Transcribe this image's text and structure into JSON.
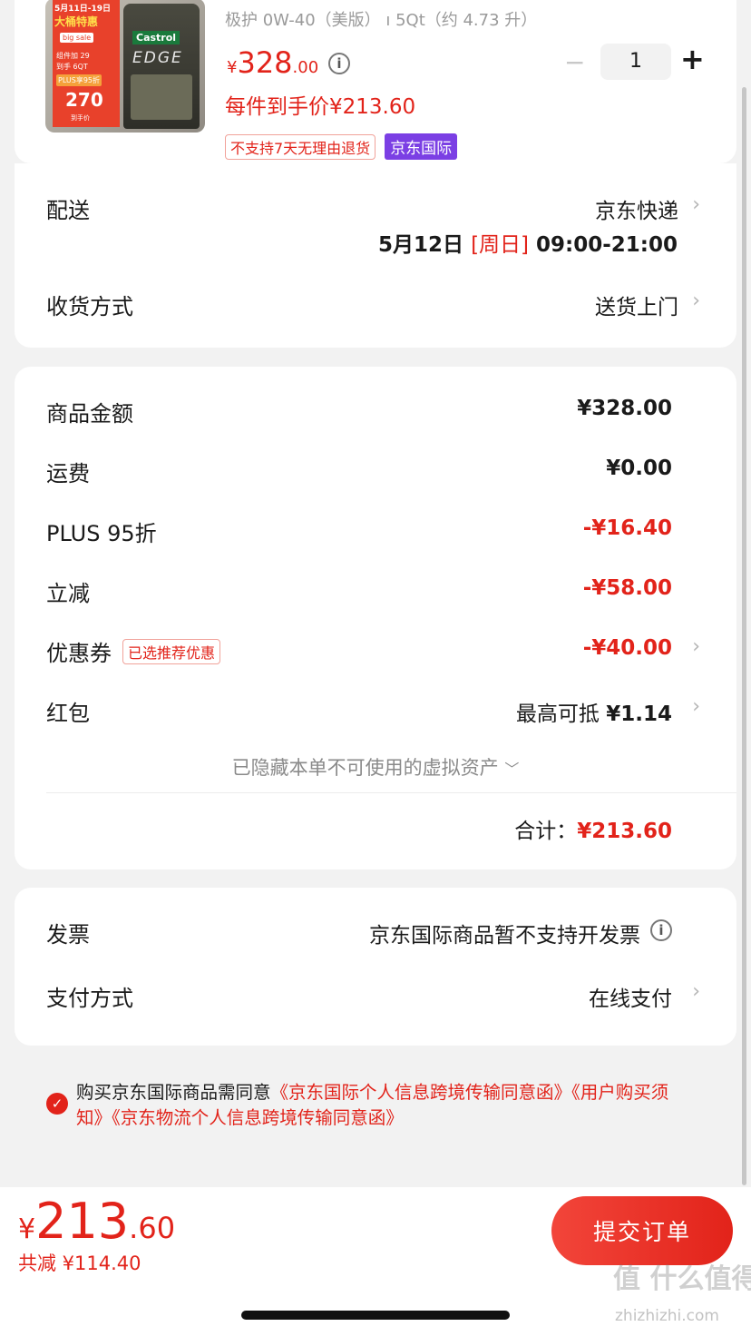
{
  "product": {
    "title_partial": "极护 0W-40（美版） ı 5Qt（约 4.73 升）",
    "price_symbol": "¥",
    "price_int": "328",
    "price_dec": ".00",
    "per_item_price": "每件到手价¥213.60",
    "quantity": "1",
    "minus": "−",
    "plus": "+",
    "tag_no_return": "不支持7天无理由退货",
    "tag_jd_intl": "京东国际",
    "image_text": {
      "date_banner": "5月11日-19日",
      "promo_title": "大桶特惠",
      "big_sale": "big sale",
      "promo_line1": "组件加 29",
      "promo_line2": "到手 6QT",
      "plus_badge": "PLUS享95折",
      "price_display": "270",
      "brand": "Castrol",
      "product_name": "EDGE",
      "footnote": "到手价"
    }
  },
  "delivery": {
    "label": "配送",
    "method": "京东快递",
    "date": "5月12日",
    "weekday": "[周日]",
    "time": "09:00-21:00",
    "receive_label": "收货方式",
    "receive_value": "送货上门"
  },
  "summary": {
    "rows": [
      {
        "label": "商品金额",
        "value": "¥328.00"
      },
      {
        "label": "运费",
        "value": "¥0.00"
      },
      {
        "label": "PLUS 95折",
        "value": "-¥16.40"
      },
      {
        "label": "立减",
        "value": "-¥58.00"
      },
      {
        "label": "优惠券",
        "tag": "已选推荐优惠",
        "value": "-¥40.00"
      },
      {
        "label": "红包",
        "value_prefix": "最高可抵",
        "value": "¥1.14"
      }
    ],
    "hidden_assets": "已隐藏本单不可使用的虚拟资产",
    "total_label": "合计：",
    "total_value": "¥213.60"
  },
  "invoice": {
    "label": "发票",
    "value": "京东国际商品暂不支持开发票",
    "pay_label": "支付方式",
    "pay_value": "在线支付"
  },
  "agreement": {
    "prefix": "购买京东国际商品需同意",
    "link1": "《京东国际个人信息跨境传输同意函》",
    "link2": "《用户购买须知》",
    "link3": "《京东物流个人信息跨境传输同意函》"
  },
  "bottom": {
    "currency": "¥",
    "price_int": "213",
    "price_dec": ".60",
    "saved": "共减 ¥114.40",
    "submit": "提交订单"
  },
  "watermark": "值 什么值得买",
  "watermark_url": "zhizhizhi.com",
  "colors": {
    "accent": "#e2231a",
    "purple": "#7b3fe4",
    "background": "#f2f2f2"
  }
}
